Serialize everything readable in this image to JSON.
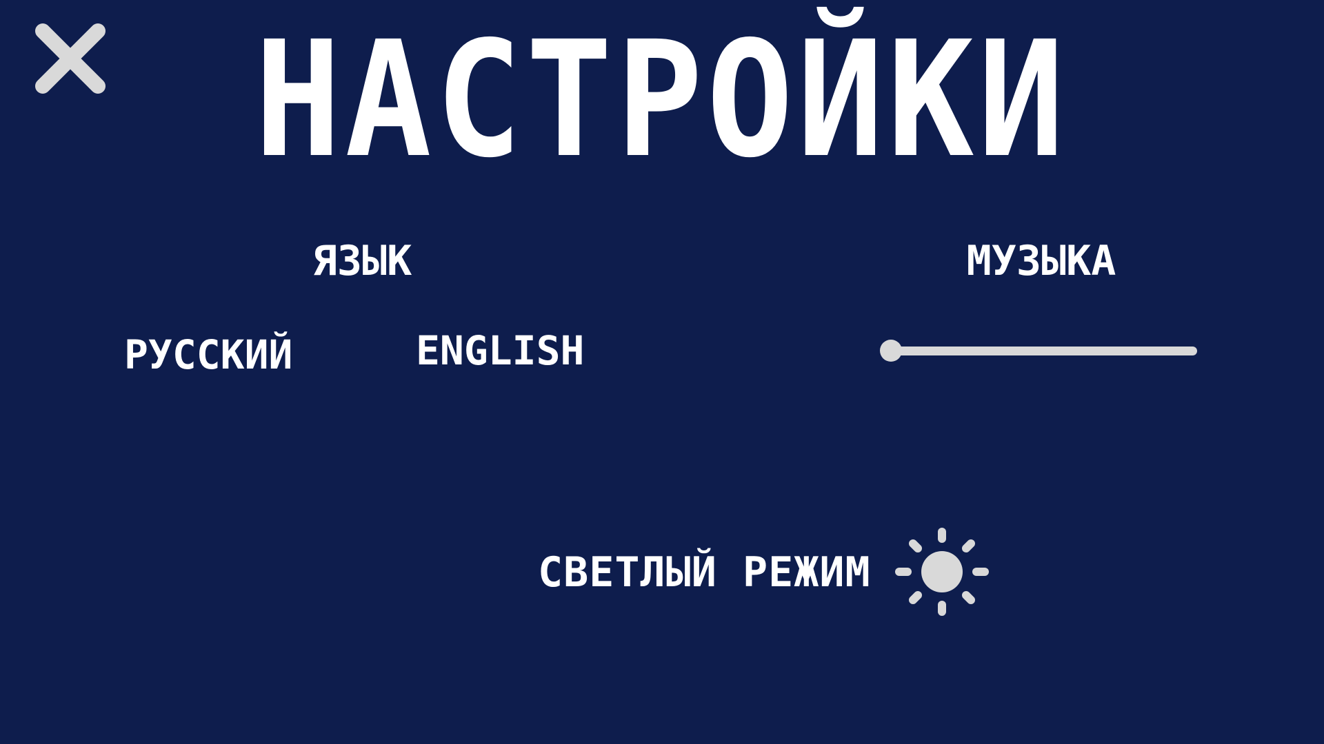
{
  "title": "НАСТРОЙКИ",
  "language": {
    "label": "ЯЗЫК",
    "options": [
      "РУССКИЙ",
      "ENGLISH"
    ]
  },
  "music": {
    "label": "МУЗЫКА",
    "volume": 0.0
  },
  "theme": {
    "label": "СВЕТЛЫЙ РЕЖИМ",
    "icon": "sun-icon"
  },
  "close": {
    "icon": "close-icon"
  },
  "colors": {
    "background": "#0e1d4d",
    "text": "#ffffff",
    "control": "#d9d9d9"
  }
}
